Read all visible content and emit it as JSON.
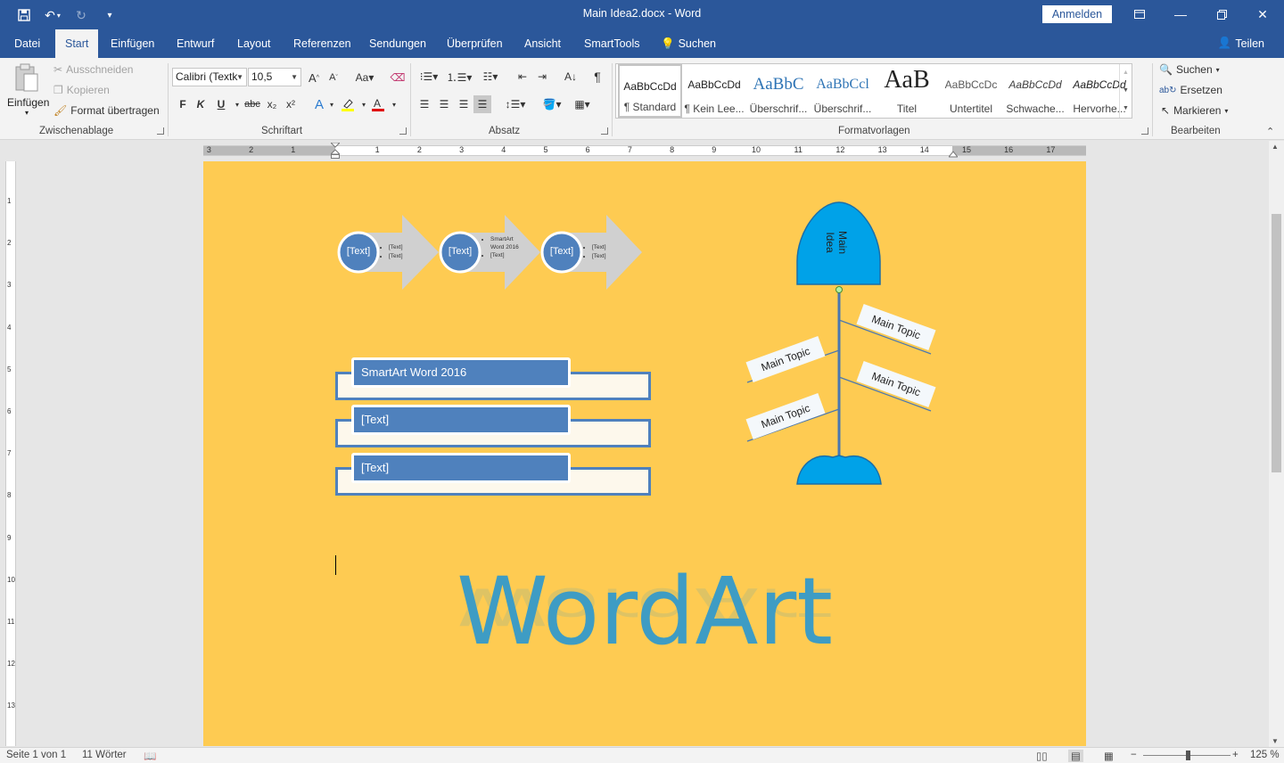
{
  "window": {
    "title": "Main Idea2.docx  -  Word",
    "sign_in": "Anmelden"
  },
  "tabs": [
    {
      "label": "Datei"
    },
    {
      "label": "Start"
    },
    {
      "label": "Einfügen"
    },
    {
      "label": "Entwurf"
    },
    {
      "label": "Layout"
    },
    {
      "label": "Referenzen"
    },
    {
      "label": "Sendungen"
    },
    {
      "label": "Überprüfen"
    },
    {
      "label": "Ansicht"
    },
    {
      "label": "SmartTools"
    }
  ],
  "tell_me": "Suchen",
  "share": "Teilen",
  "ribbon": {
    "clipboard": {
      "label": "Zwischenablage",
      "paste": "Einfügen",
      "cut": "Ausschneiden",
      "copy": "Kopieren",
      "format_painter": "Format übertragen"
    },
    "font": {
      "label": "Schriftart",
      "font_name": "Calibri (Textk",
      "font_size": "10,5",
      "bold": "F",
      "italic": "K",
      "underline": "U",
      "strike": "abc",
      "subscript": "x₂",
      "superscript": "x²"
    },
    "paragraph": {
      "label": "Absatz"
    },
    "styles": {
      "label": "Formatvorlagen",
      "items": [
        {
          "preview": "AaBbCcDd",
          "name": "¶ Standard"
        },
        {
          "preview": "AaBbCcDd",
          "name": "¶ Kein Lee..."
        },
        {
          "preview": "AaBbC",
          "name": "Überschrif..."
        },
        {
          "preview": "AaBbCcl",
          "name": "Überschrif..."
        },
        {
          "preview": "AaB",
          "name": "Titel"
        },
        {
          "preview": "AaBbCcDc",
          "name": "Untertitel"
        },
        {
          "preview": "AaBbCcDd",
          "name": "Schwache..."
        },
        {
          "preview": "AaBbCcDd",
          "name": "Hervorhe..."
        }
      ]
    },
    "editing": {
      "label": "Bearbeiten",
      "find": "Suchen",
      "replace": "Ersetzen",
      "select": "Markieren"
    }
  },
  "ruler": {
    "h_labels": [
      "3",
      "2",
      "1",
      "1",
      "2",
      "3",
      "4",
      "5",
      "6",
      "7",
      "8",
      "9",
      "10",
      "11",
      "12",
      "13",
      "14",
      "15",
      "16",
      "17"
    ],
    "v_labels": [
      "1",
      "2",
      "3",
      "4",
      "5",
      "6",
      "7",
      "8",
      "9",
      "10",
      "11",
      "12",
      "13"
    ]
  },
  "document": {
    "process_steps": [
      {
        "circle": "[Text]",
        "bullets": [
          "[Text]",
          "[Text]"
        ]
      },
      {
        "circle": "[Text]",
        "bullets": [
          "SmartArt Word 2016",
          "[Text]"
        ]
      },
      {
        "circle": "[Text]",
        "bullets": [
          "[Text]",
          "[Text]"
        ]
      }
    ],
    "list_items": [
      "SmartArt Word 2016",
      "[Text]",
      "[Text]"
    ],
    "fishbone": {
      "head": "Main Idea",
      "topics": [
        "Main Topic",
        "Main Topic",
        "Main Topic",
        "Main Topic"
      ]
    },
    "wordart": "WordArt"
  },
  "status": {
    "page": "Seite 1 von 1",
    "words": "11 Wörter",
    "zoom": "125 %"
  },
  "colors": {
    "ribbon_blue": "#2b579a",
    "page_background": "#fecb52",
    "smartart_blue": "#4f81bd",
    "fishbone_cyan": "#00a2e8"
  }
}
